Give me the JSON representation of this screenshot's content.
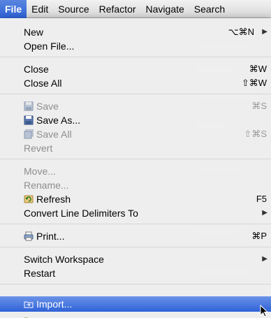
{
  "menubar": {
    "items": [
      "File",
      "Edit",
      "Source",
      "Refactor",
      "Navigate",
      "Search"
    ]
  },
  "menu": {
    "new": {
      "label": "New",
      "shortcut": "⌥⌘N"
    },
    "open_file": {
      "label": "Open File..."
    },
    "close": {
      "label": "Close",
      "shortcut": "⌘W"
    },
    "close_all": {
      "label": "Close All",
      "shortcut": "⇧⌘W"
    },
    "save": {
      "label": "Save",
      "shortcut": "⌘S",
      "icon": "disk-icon"
    },
    "save_as": {
      "label": "Save As...",
      "icon": "save-as-icon"
    },
    "save_all": {
      "label": "Save All",
      "shortcut": "⇧⌘S",
      "icon": "save-all-icon"
    },
    "revert": {
      "label": "Revert"
    },
    "move": {
      "label": "Move..."
    },
    "rename": {
      "label": "Rename..."
    },
    "refresh": {
      "label": "Refresh",
      "shortcut": "F5",
      "icon": "refresh-icon"
    },
    "convert": {
      "label": "Convert Line Delimiters To"
    },
    "print": {
      "label": "Print...",
      "shortcut": "⌘P",
      "icon": "printer-icon"
    },
    "switch_workspace": {
      "label": "Switch Workspace"
    },
    "restart": {
      "label": "Restart"
    },
    "import": {
      "label": "Import...",
      "icon": "import-icon"
    }
  },
  "colors": {
    "selection": "#2f62d8",
    "disabled_text": "#8e8e8e"
  }
}
